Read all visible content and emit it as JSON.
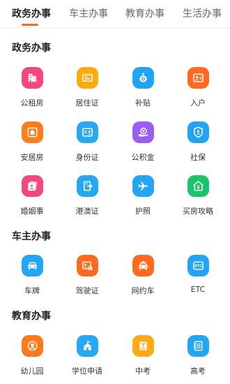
{
  "tabs": [
    {
      "label": "政务办事",
      "active": true
    },
    {
      "label": "车主办事",
      "active": false
    },
    {
      "label": "教育办事",
      "active": false
    },
    {
      "label": "生活办事",
      "active": false
    }
  ],
  "sections": [
    {
      "title": "政务办事",
      "items": [
        {
          "label": "公租房",
          "icon": "building-icon",
          "color": "#f4477c"
        },
        {
          "label": "居住证",
          "icon": "id-card-icon",
          "color": "#ffab10"
        },
        {
          "label": "补贴",
          "icon": "money-bag-icon",
          "color": "#20a4f3"
        },
        {
          "label": "入户",
          "icon": "profile-card-icon",
          "color": "#ff6a1f"
        },
        {
          "label": "安居房",
          "icon": "house-icon",
          "color": "#ff7d1a"
        },
        {
          "label": "身份证",
          "icon": "id-badge-icon",
          "color": "#27a8f2"
        },
        {
          "label": "公积金",
          "icon": "hand-coin-icon",
          "color": "#9b5ef5"
        },
        {
          "label": "社保",
          "icon": "shield-user-icon",
          "color": "#20a4f3"
        },
        {
          "label": "婚姻事",
          "icon": "marriage-cert-icon",
          "color": "#f5487a"
        },
        {
          "label": "港澳证",
          "icon": "exit-door-icon",
          "color": "#22a9f0"
        },
        {
          "label": "护照",
          "icon": "airplane-icon",
          "color": "#23a6f3"
        },
        {
          "label": "买房攻略",
          "icon": "house-price-icon",
          "color": "#1bc46b"
        }
      ]
    },
    {
      "title": "车主办事",
      "items": [
        {
          "label": "车牌",
          "icon": "car-icon",
          "color": "#23a6f3"
        },
        {
          "label": "驾驶证",
          "icon": "license-card-icon",
          "color": "#ff6a1f"
        },
        {
          "label": "网约车",
          "icon": "taxi-icon",
          "color": "#ff6a1f"
        },
        {
          "label": "ETC",
          "icon": "etc-icon",
          "color": "#20a4f3"
        }
      ]
    },
    {
      "title": "教育办事",
      "items": [
        {
          "label": "幼儿园",
          "icon": "kindergarten-icon",
          "color": "#ff7a1a"
        },
        {
          "label": "学位申请",
          "icon": "school-icon",
          "color": "#26a8f2"
        },
        {
          "label": "中考",
          "icon": "exam-book-icon",
          "color": "#ffaa12"
        },
        {
          "label": "高考",
          "icon": "exam-paper-icon",
          "color": "#23a6f3"
        }
      ]
    }
  ]
}
